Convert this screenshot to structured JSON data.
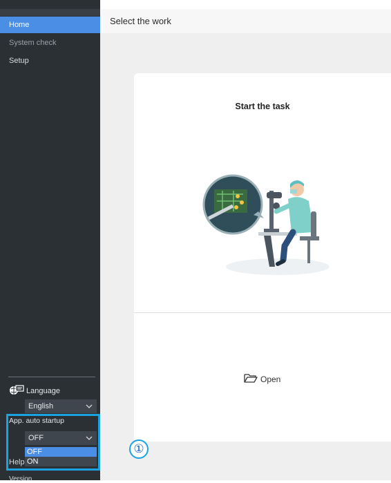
{
  "sidebar": {
    "items": [
      {
        "label": "Home",
        "active": true
      },
      {
        "label": "System check",
        "active": false
      },
      {
        "label": "Setup",
        "active": false
      }
    ],
    "language": {
      "label": "Language",
      "value": "English"
    },
    "auto_startup": {
      "label": "App. auto startup",
      "value": "OFF",
      "options": [
        "OFF",
        "ON"
      ]
    },
    "help_label": "Help",
    "version_label": "Version"
  },
  "header": {
    "title": "Select the work"
  },
  "card": {
    "title": "Start the task",
    "open_label": "Open"
  },
  "callout": {
    "label": "①"
  },
  "colors": {
    "accent": "#4a8ee6",
    "highlight": "#1aa3e0",
    "sidebar_bg": "#2b3035"
  }
}
